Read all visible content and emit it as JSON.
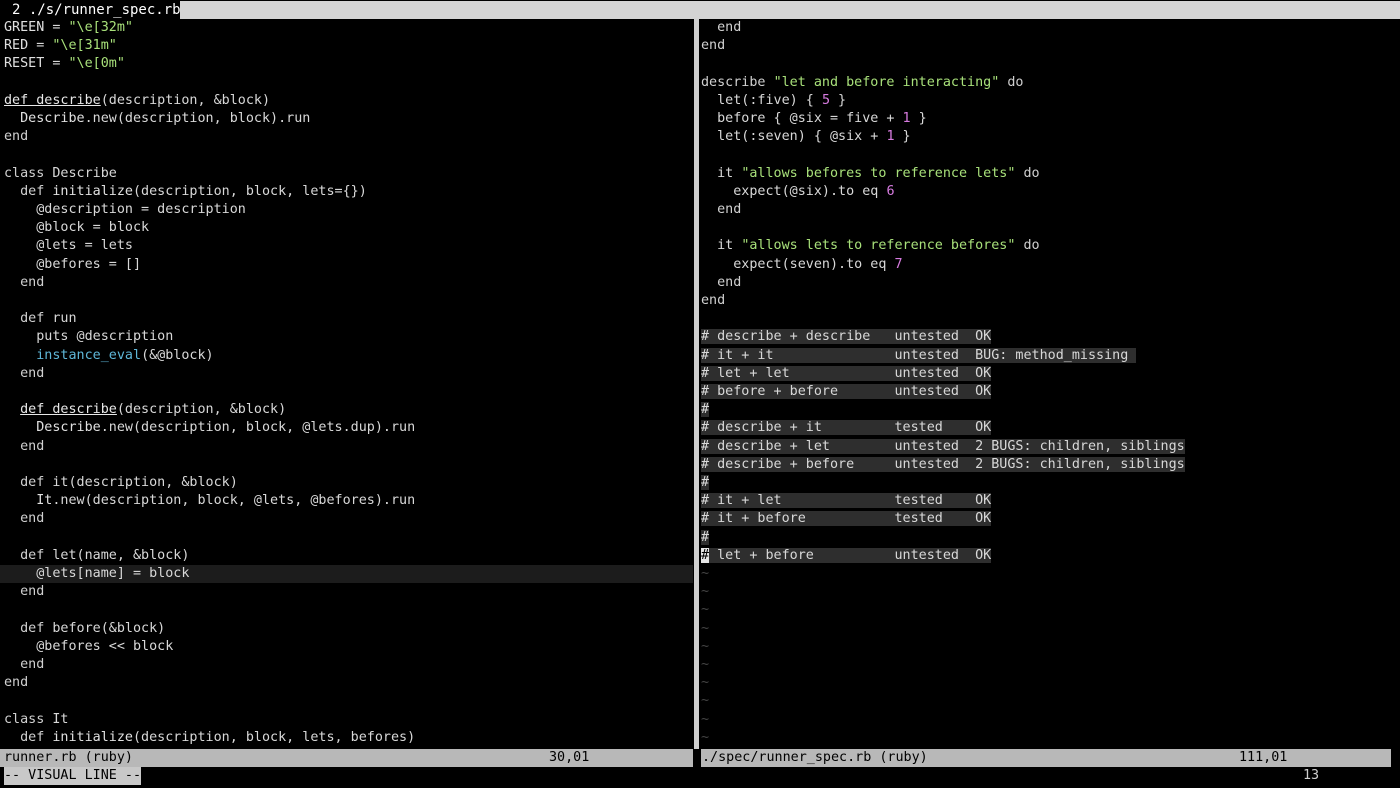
{
  "tabline": {
    "tab_label": "2 ./s/runner_spec.rb"
  },
  "left_pane": {
    "cursor_line_index": 30,
    "lines": [
      [
        [
          "const",
          "GREEN"
        ],
        [
          "plain",
          " = "
        ],
        [
          "str",
          "\"\\e[32m\""
        ]
      ],
      [
        [
          "const",
          "RED"
        ],
        [
          "plain",
          " = "
        ],
        [
          "str",
          "\"\\e[31m\""
        ]
      ],
      [
        [
          "const",
          "RESET"
        ],
        [
          "plain",
          " = "
        ],
        [
          "str",
          "\"\\e[0m\""
        ]
      ],
      [],
      [
        [
          "def",
          "def describe"
        ],
        [
          "plain",
          "(description, &block)"
        ]
      ],
      [
        [
          "plain",
          "  "
        ],
        [
          "const",
          "Describe"
        ],
        [
          "plain",
          ".new(description, block).run"
        ]
      ],
      [
        [
          "kw",
          "end"
        ]
      ],
      [],
      [
        [
          "kw",
          "class"
        ],
        [
          "plain",
          " Describe"
        ]
      ],
      [
        [
          "plain",
          "  "
        ],
        [
          "kw",
          "def"
        ],
        [
          "plain",
          " "
        ],
        [
          "const",
          "initialize"
        ],
        [
          "plain",
          "(description, block, lets={})"
        ]
      ],
      [
        [
          "plain",
          "    @description = description"
        ]
      ],
      [
        [
          "plain",
          "    @block = block"
        ]
      ],
      [
        [
          "plain",
          "    @lets = lets"
        ]
      ],
      [
        [
          "plain",
          "    @befores = []"
        ]
      ],
      [
        [
          "plain",
          "  "
        ],
        [
          "kw",
          "end"
        ]
      ],
      [],
      [
        [
          "plain",
          "  "
        ],
        [
          "kw",
          "def"
        ],
        [
          "plain",
          " run"
        ]
      ],
      [
        [
          "plain",
          "    puts @description"
        ]
      ],
      [
        [
          "plain",
          "    "
        ],
        [
          "builtin",
          "instance_eval"
        ],
        [
          "plain",
          "(&@block)"
        ]
      ],
      [
        [
          "plain",
          "  "
        ],
        [
          "kw",
          "end"
        ]
      ],
      [],
      [
        [
          "plain",
          "  "
        ],
        [
          "def",
          "def describe"
        ],
        [
          "plain",
          "(description, &block)"
        ]
      ],
      [
        [
          "plain",
          "    "
        ],
        [
          "const",
          "Describe"
        ],
        [
          "plain",
          ".new(description, block, @lets.dup).run"
        ]
      ],
      [
        [
          "plain",
          "  "
        ],
        [
          "kw",
          "end"
        ]
      ],
      [],
      [
        [
          "plain",
          "  "
        ],
        [
          "kw",
          "def"
        ],
        [
          "plain",
          " it(description, &block)"
        ]
      ],
      [
        [
          "plain",
          "    "
        ],
        [
          "const",
          "It"
        ],
        [
          "plain",
          ".new(description, block, @lets, @befores).run"
        ]
      ],
      [
        [
          "plain",
          "  "
        ],
        [
          "kw",
          "end"
        ]
      ],
      [],
      [
        [
          "plain",
          "  "
        ],
        [
          "kw",
          "def"
        ],
        [
          "plain",
          " let(name, &block)"
        ]
      ],
      [
        [
          "plain",
          "    @lets[name] = block"
        ]
      ],
      [
        [
          "plain",
          "  "
        ],
        [
          "kw",
          "end"
        ]
      ],
      [],
      [
        [
          "plain",
          "  "
        ],
        [
          "kw",
          "def"
        ],
        [
          "plain",
          " before(&block)"
        ]
      ],
      [
        [
          "plain",
          "    @befores << block"
        ]
      ],
      [
        [
          "plain",
          "  "
        ],
        [
          "kw",
          "end"
        ]
      ],
      [
        [
          "kw",
          "end"
        ]
      ],
      [],
      [
        [
          "kw",
          "class"
        ],
        [
          "plain",
          " It"
        ]
      ],
      [
        [
          "plain",
          "  "
        ],
        [
          "kw",
          "def"
        ],
        [
          "plain",
          " "
        ],
        [
          "const",
          "initialize"
        ],
        [
          "plain",
          "(description, block, lets, befores)"
        ]
      ]
    ]
  },
  "right_pane": {
    "lines": [
      [
        [
          "plain",
          "  "
        ],
        [
          "kw",
          "end"
        ]
      ],
      [
        [
          "kw",
          "end"
        ]
      ],
      [],
      [
        [
          "kw",
          "describe"
        ],
        [
          "plain",
          " "
        ],
        [
          "str",
          "\"let and before interacting\""
        ],
        [
          "plain",
          " "
        ],
        [
          "kw",
          "do"
        ]
      ],
      [
        [
          "plain",
          "  let(:five) { "
        ],
        [
          "num",
          "5"
        ],
        [
          "plain",
          " }"
        ]
      ],
      [
        [
          "plain",
          "  before { @six = five + "
        ],
        [
          "num",
          "1"
        ],
        [
          "plain",
          " }"
        ]
      ],
      [
        [
          "plain",
          "  let(:seven) { @six + "
        ],
        [
          "num",
          "1"
        ],
        [
          "plain",
          " }"
        ]
      ],
      [],
      [
        [
          "plain",
          "  it "
        ],
        [
          "str",
          "\"allows befores to reference lets\""
        ],
        [
          "plain",
          " "
        ],
        [
          "kw",
          "do"
        ]
      ],
      [
        [
          "plain",
          "    expect(@six).to eq "
        ],
        [
          "num",
          "6"
        ]
      ],
      [
        [
          "plain",
          "  "
        ],
        [
          "kw",
          "end"
        ]
      ],
      [],
      [
        [
          "plain",
          "  it "
        ],
        [
          "str",
          "\"allows lets to reference befores\""
        ],
        [
          "plain",
          " "
        ],
        [
          "kw",
          "do"
        ]
      ],
      [
        [
          "plain",
          "    expect(seven).to eq "
        ],
        [
          "num",
          "7"
        ]
      ],
      [
        [
          "plain",
          "  "
        ],
        [
          "kw",
          "end"
        ]
      ],
      [
        [
          "kw",
          "end"
        ]
      ],
      [],
      [
        [
          "sel",
          "# describe + describe   untested  OK"
        ]
      ],
      [
        [
          "sel",
          "# it + it               untested  BUG: method_missing "
        ]
      ],
      [
        [
          "sel",
          "# let + let             untested  OK"
        ]
      ],
      [
        [
          "sel",
          "# before + before       untested  OK"
        ]
      ],
      [
        [
          "sel",
          "#"
        ]
      ],
      [
        [
          "sel",
          "# describe + it         tested    OK"
        ]
      ],
      [
        [
          "sel",
          "# describe + let        untested  2 BUGS: children, siblings"
        ]
      ],
      [
        [
          "sel",
          "# describe + before     untested  2 BUGS: children, siblings"
        ]
      ],
      [
        [
          "sel",
          "#"
        ]
      ],
      [
        [
          "sel",
          "# it + let              tested    OK"
        ]
      ],
      [
        [
          "sel",
          "# it + before           tested    OK"
        ]
      ],
      [
        [
          "sel",
          "#"
        ]
      ],
      [
        [
          "viscursor",
          "#"
        ],
        [
          "sel",
          " let + before          untested  OK"
        ]
      ],
      [
        [
          "tilde",
          "~"
        ]
      ],
      [
        [
          "tilde",
          "~"
        ]
      ],
      [
        [
          "tilde",
          "~"
        ]
      ],
      [
        [
          "tilde",
          "~"
        ]
      ],
      [
        [
          "tilde",
          "~"
        ]
      ],
      [
        [
          "tilde",
          "~"
        ]
      ],
      [
        [
          "tilde",
          "~"
        ]
      ],
      [
        [
          "tilde",
          "~"
        ]
      ],
      [
        [
          "tilde",
          "~"
        ]
      ],
      [
        [
          "tilde",
          "~"
        ]
      ]
    ]
  },
  "status": {
    "left_file": "runner.rb (ruby)",
    "left_pos": "30,01",
    "right_file": "./spec/runner_spec.rb (ruby)",
    "right_pos": "111,01"
  },
  "cmdline": {
    "mode": "-- VISUAL LINE --",
    "selected_count": "13"
  },
  "colors": {
    "background": "#000000",
    "string": "#a8e07a",
    "number": "#d77be0",
    "builtin": "#5fb7d8",
    "statusline": "#b8b8b8"
  }
}
